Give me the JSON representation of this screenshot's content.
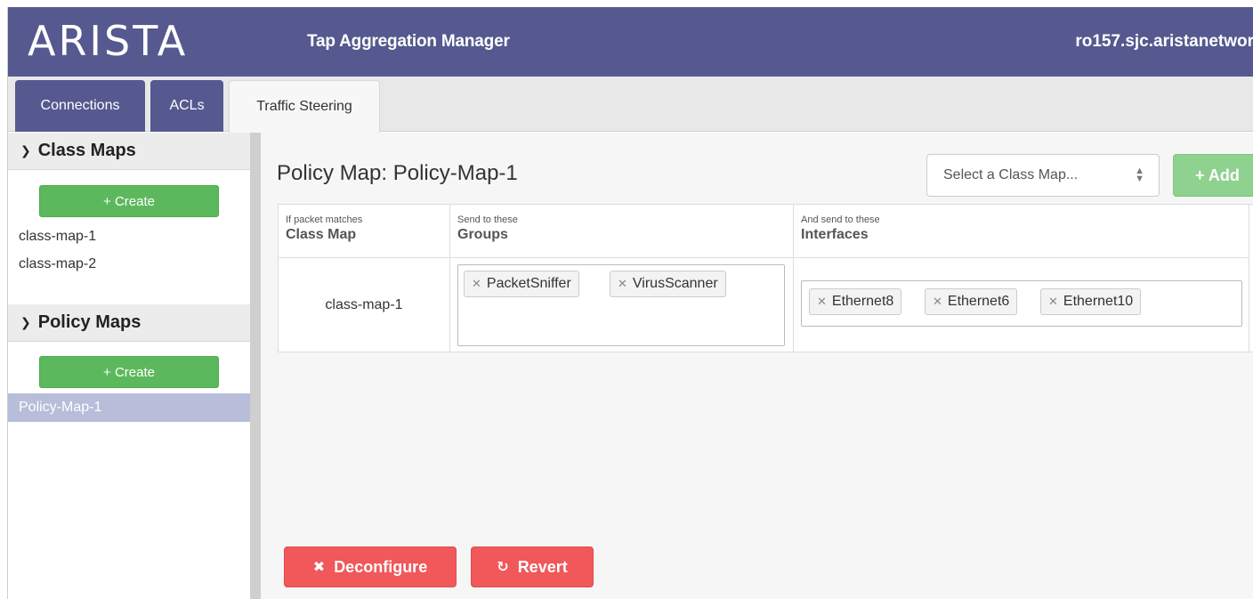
{
  "header": {
    "logo_text": "ARISTA",
    "app_title": "Tap Aggregation Manager",
    "hostname": "ro157.sjc.aristanetwor"
  },
  "tabs": [
    {
      "label": "Connections"
    },
    {
      "label": "ACLs"
    },
    {
      "label": "Traffic Steering",
      "active": true
    }
  ],
  "sidebar": {
    "class_maps": {
      "title": "Class Maps",
      "create_label": "+ Create",
      "items": [
        "class-map-1",
        "class-map-2"
      ]
    },
    "policy_maps": {
      "title": "Policy Maps",
      "create_label": "+ Create",
      "items": [
        "Policy-Map-1"
      ],
      "selected": "Policy-Map-1"
    }
  },
  "main": {
    "title": "Policy Map: Policy-Map-1",
    "class_map_select": {
      "value": "Select a Class Map..."
    },
    "add_label": "+ Add",
    "table": {
      "columns": [
        {
          "small": "If packet matches",
          "big": "Class Map"
        },
        {
          "small": "Send to these",
          "big": "Groups"
        },
        {
          "small": "And send to these",
          "big": "Interfaces"
        }
      ],
      "rows": [
        {
          "class_map": "class-map-1",
          "groups": [
            "PacketSniffer",
            "VirusScanner"
          ],
          "interfaces": [
            "Ethernet8",
            "Ethernet6",
            "Ethernet10"
          ]
        }
      ]
    },
    "deconfigure_label": "Deconfigure",
    "revert_label": "Revert"
  },
  "colors": {
    "header_bg": "#55598f",
    "create_green": "#5cb85c",
    "add_green": "#8fd18f",
    "danger_red": "#f0585a",
    "selection": "#b8bdd9"
  }
}
